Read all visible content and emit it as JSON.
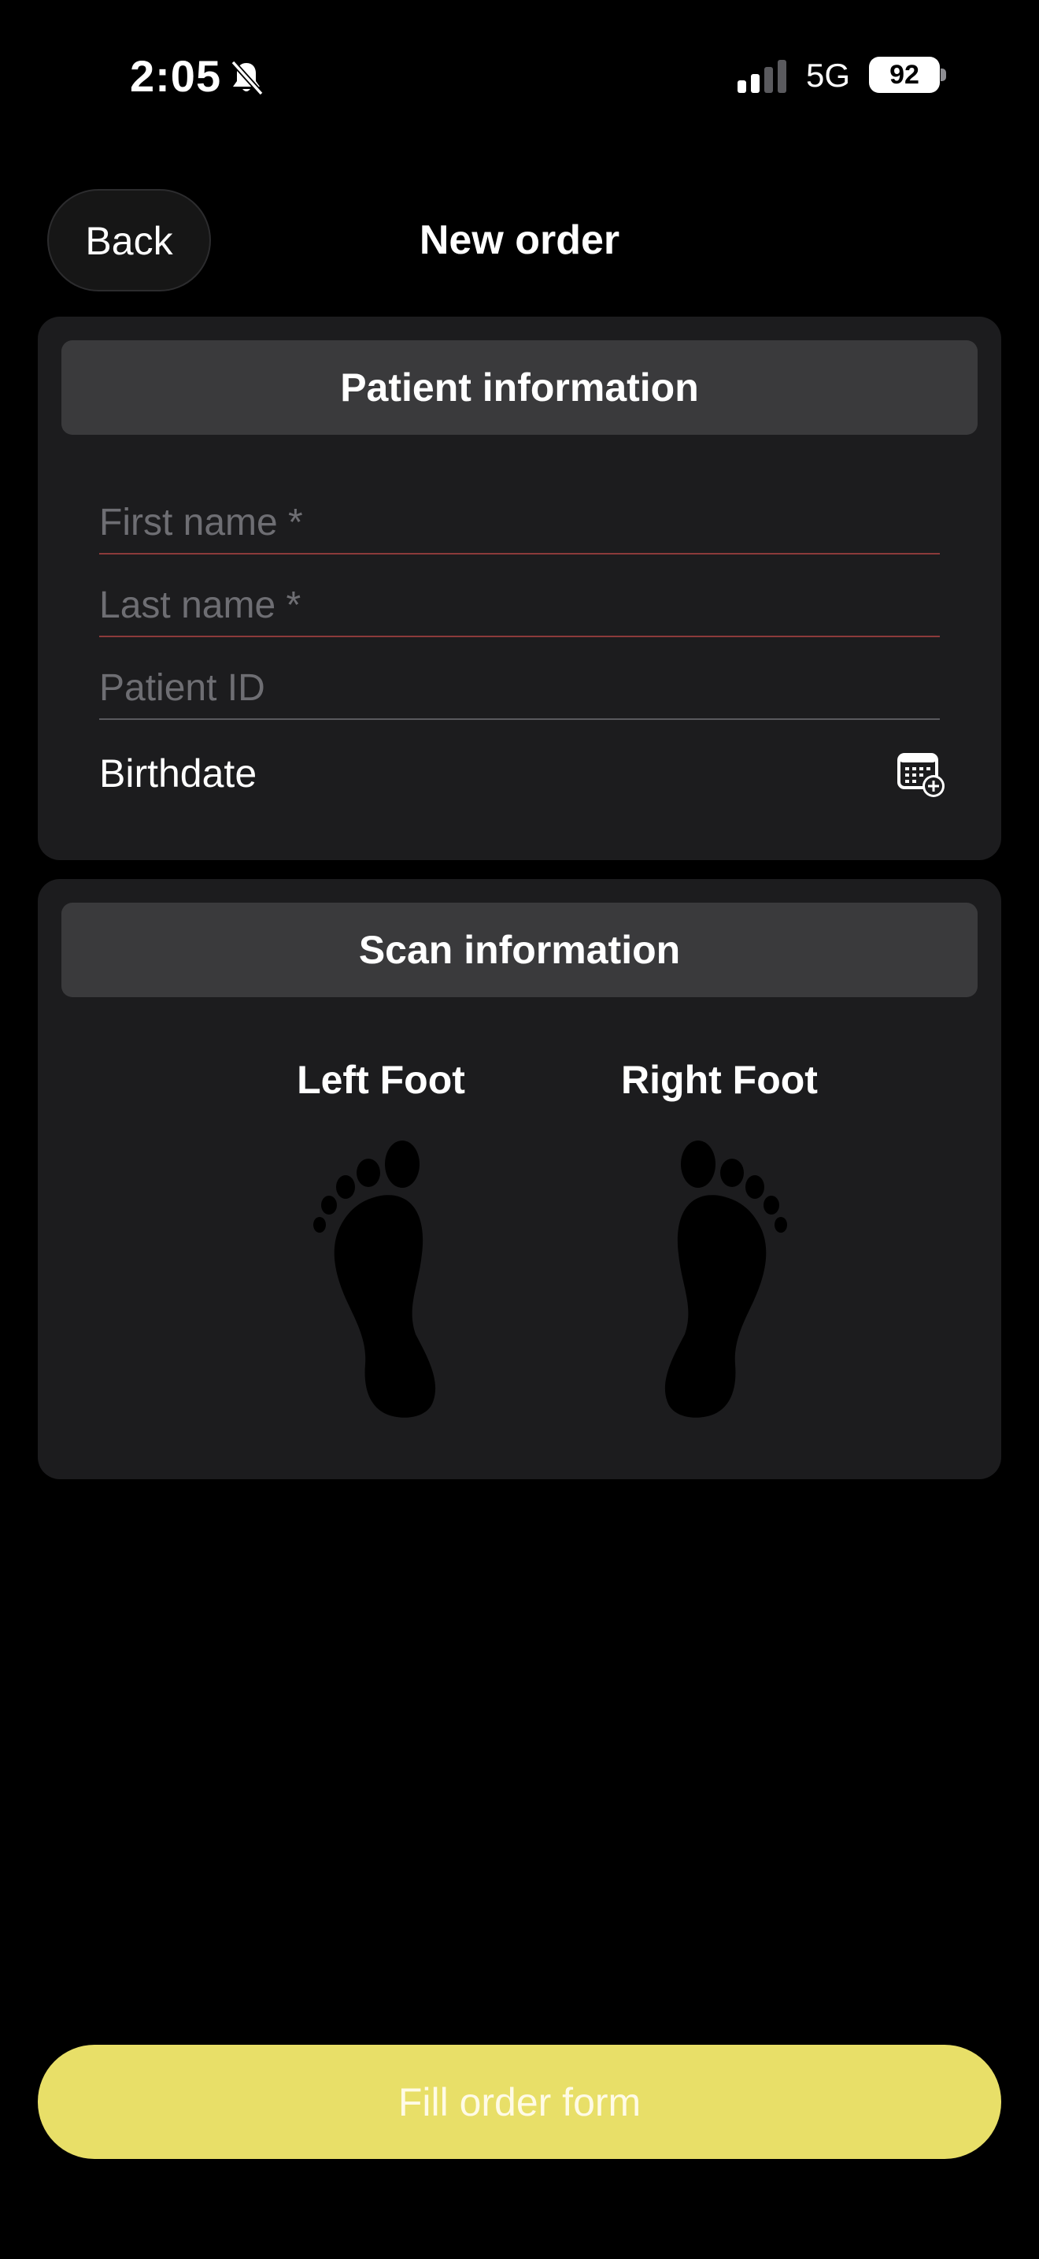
{
  "status_bar": {
    "time": "2:05",
    "network": "5G",
    "battery": "92",
    "icons": [
      "bell-slash-icon",
      "signal-icon",
      "battery-icon"
    ]
  },
  "nav": {
    "back_label": "Back",
    "title": "New order"
  },
  "patient_section": {
    "header": "Patient information",
    "first_name_placeholder": "First name *",
    "last_name_placeholder": "Last name *",
    "patient_id_placeholder": "Patient ID",
    "birthdate_label": "Birthdate",
    "birthdate_icon": "calendar-add-icon"
  },
  "scan_section": {
    "header": "Scan information",
    "left_foot_label": "Left Foot",
    "right_foot_label": "Right Foot",
    "foot_icon": "footprint-icon"
  },
  "actions": {
    "fill_order_label": "Fill order form"
  },
  "colors": {
    "background": "#000000",
    "card": "#1c1c1e",
    "section_header": "#3a3a3c",
    "required_underline": "#8c3a3a",
    "primary_button": "#e8df68"
  }
}
